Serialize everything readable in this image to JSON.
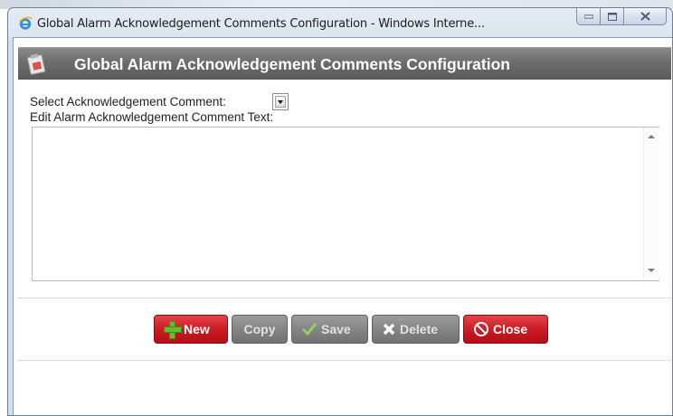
{
  "window": {
    "title": "Global Alarm Acknowledgement Comments Configuration - Windows Interne..."
  },
  "dialog": {
    "header_title": "Global Alarm Acknowledgement Comments Configuration"
  },
  "form": {
    "select_label": "Select Acknowledgement Comment:",
    "selected_value": "",
    "edit_label": "Edit Alarm Acknowledgement Comment Text:",
    "comment_text": ""
  },
  "buttons": {
    "new": "New",
    "copy": "Copy",
    "save": "Save",
    "delete": "Delete",
    "close": "Close"
  },
  "colors": {
    "header_bg": "#6d6d6d",
    "button_active": "#cc1c24",
    "button_disabled": "#858585"
  },
  "icons": [
    "ie-icon",
    "minimize-icon",
    "maximize-icon",
    "close-icon",
    "clipboard-icon",
    "plus-icon",
    "check-icon",
    "x-icon",
    "no-entry-icon",
    "dropdown-arrow-icon"
  ]
}
